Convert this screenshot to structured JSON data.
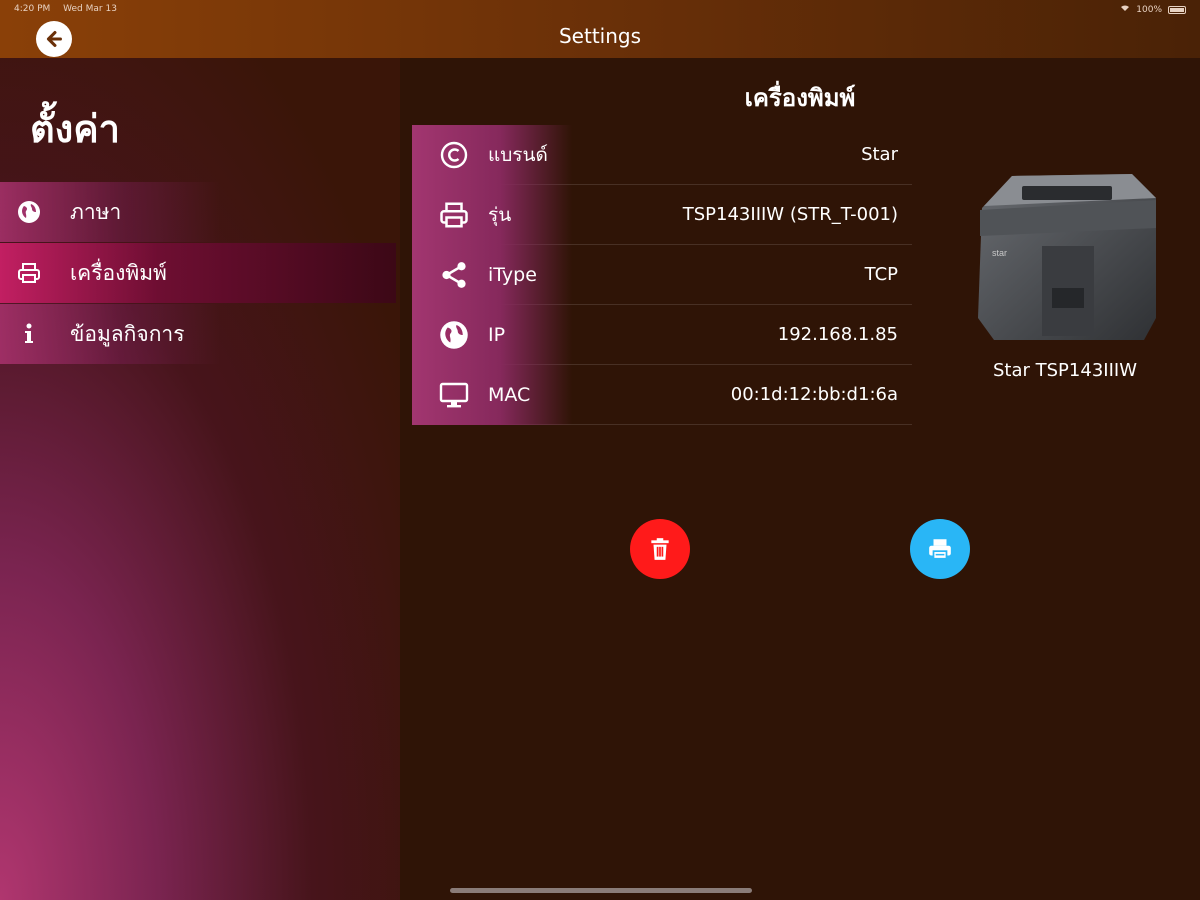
{
  "status_bar": {
    "time": "4:20 PM",
    "date": "Wed Mar 13",
    "battery": "100%",
    "icons": [
      "wifi-icon",
      "battery-icon"
    ]
  },
  "nav": {
    "title": "Settings",
    "back_icon": "arrow-left-icon"
  },
  "sidebar": {
    "title": "ตั้งค่า",
    "items": [
      {
        "label": "ภาษา",
        "icon": "globe-icon",
        "active": false
      },
      {
        "label": "เครื่องพิมพ์",
        "icon": "printer-icon",
        "active": true
      },
      {
        "label": "ข้อมูลกิจการ",
        "icon": "info-icon",
        "active": false
      }
    ]
  },
  "panel": {
    "title": "เครื่องพิมพ์",
    "rows": [
      {
        "icon": "copyright-icon",
        "key": "แบรนด์",
        "value": "Star"
      },
      {
        "icon": "printer-icon",
        "key": "รุ่น",
        "value": "TSP143IIIW (STR_T-001)"
      },
      {
        "icon": "share-icon",
        "key": "iType",
        "value": "TCP"
      },
      {
        "icon": "globe-icon",
        "key": "IP",
        "value": "192.168.1.85"
      },
      {
        "icon": "monitor-icon",
        "key": "MAC",
        "value": "00:1d:12:bb:d1:6a"
      }
    ],
    "printer_name": "Star TSP143IIIW"
  },
  "actions": {
    "delete_icon": "trash-icon",
    "delete_color": "#ff1a1a",
    "print_icon": "printer-icon",
    "print_color": "#29b6f6"
  },
  "colors": {
    "accent": "#c21f62",
    "background": "#2f1406",
    "topbar": "#6a3008"
  }
}
